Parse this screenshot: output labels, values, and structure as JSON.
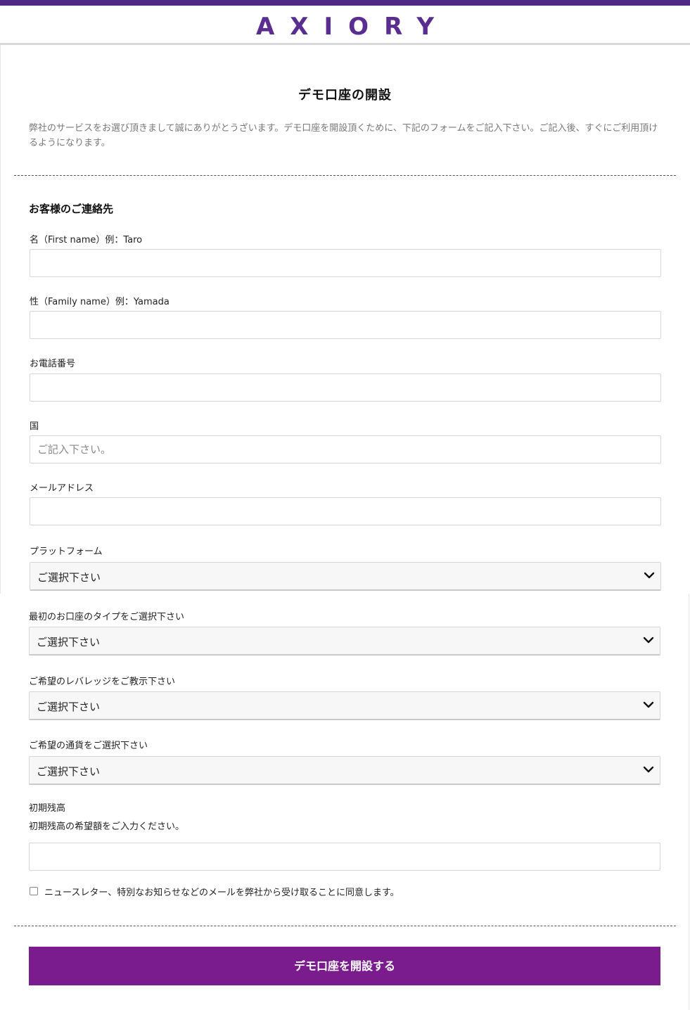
{
  "brand": {
    "logo_text": "AXIORY",
    "accent": "#4e2a84",
    "button_color": "#7b1c8e"
  },
  "page": {
    "title": "デモ口座の開設",
    "intro": "弊社のサービスをお選び頂きまして誠にありがとうざいます。デモ口座を開設頂くために、下記のフォームをご記入下さい。ご記入後、すぐにご利用頂けるようになります。"
  },
  "contact": {
    "section_title": "お客様のご連絡先"
  },
  "fields": {
    "first_name": {
      "label": "名（First name）例：Taro",
      "value": "",
      "placeholder": ""
    },
    "family_name": {
      "label": "性（Family name）例：Yamada",
      "value": "",
      "placeholder": ""
    },
    "phone": {
      "label": "お電話番号",
      "value": "",
      "placeholder": ""
    },
    "country": {
      "label": "国",
      "value": "",
      "placeholder": "ご記入下さい。"
    },
    "email": {
      "label": "メールアドレス",
      "value": "",
      "placeholder": ""
    },
    "platform": {
      "label": "プラットフォーム",
      "selected": "ご選択下さい"
    },
    "account_type": {
      "label": "最初のお口座のタイプをご選択下さい",
      "selected": "ご選択下さい"
    },
    "leverage": {
      "label": "ご希望のレバレッジをご教示下さい",
      "selected": "ご選択下さい"
    },
    "currency": {
      "label": "ご希望の通貨をご選択下さい",
      "selected": "ご選択下さい"
    },
    "initial_balance": {
      "label": "初期残高",
      "help": "初期残高の希望額をご入力ください。",
      "value": "",
      "placeholder": ""
    }
  },
  "newsletter": {
    "label": "ニュースレター、特別なお知らせなどのメールを弊社から受け取ることに同意します。",
    "checked": false
  },
  "submit": {
    "label": "デモ口座を開設する"
  },
  "icons": {
    "select_arrow": "chevron-down-icon",
    "checkbox": "checkbox-icon"
  }
}
